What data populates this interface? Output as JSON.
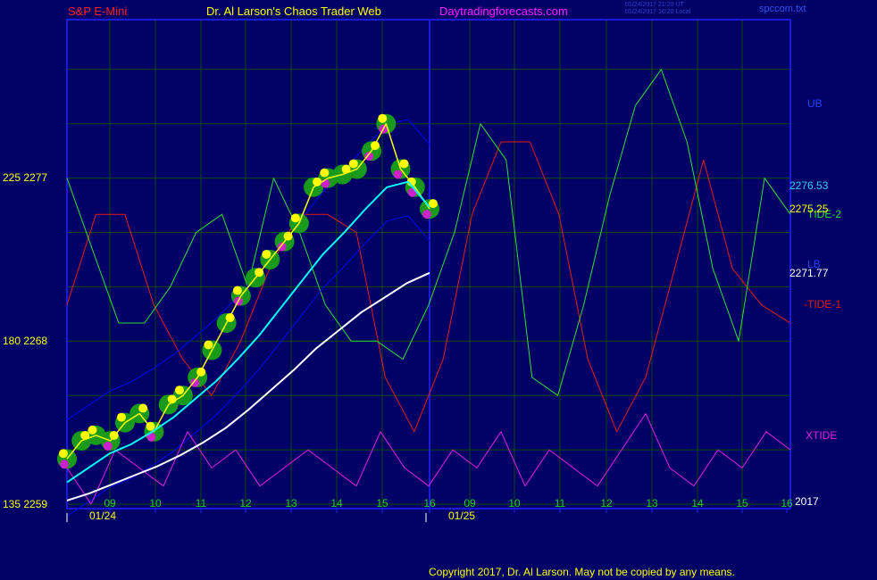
{
  "header": {
    "instrument": "S&P E-Mini",
    "brand": "Dr. Al Larson's Chaos Trader Web",
    "site": "Daytradingforecasts.com",
    "stamp_line1": "01/24/2017 21:20 UT",
    "stamp_line2": "01/24/2017 16:20 Local",
    "filename": "spccom.txt"
  },
  "footer": {
    "copyright": "Copyright 2017, Dr. Al Larson. May not be copied by any means."
  },
  "colors": {
    "background": "#000066",
    "grid": "#0b4d0b",
    "frame": "#2222ff",
    "price": "#ffff00",
    "ema_short": "#00ffff",
    "ema_long": "#ffffff",
    "tide1": "#e02010",
    "tide2": "#33dd33",
    "xtide": "#dd22dd",
    "bands": "#0000ee"
  },
  "chart_data": {
    "type": "line",
    "y_ticks": [
      "225 2277",
      "180 2268",
      "135 2259"
    ],
    "y_range": [
      2259,
      2283
    ],
    "x_ticks": [
      "09",
      "10",
      "11",
      "12",
      "13",
      "14",
      "15",
      "16",
      "09",
      "10",
      "11",
      "12",
      "13",
      "14",
      "15",
      "16"
    ],
    "dates": [
      "01/24",
      "01/25"
    ],
    "year": "2017",
    "labels": {
      "ub": "UB",
      "lb": "LB",
      "tide2": "TIDE-2",
      "tide1": "-TIDE-1",
      "xtide": "XTIDE"
    },
    "value_labels": [
      "2276.53",
      "2275.25",
      "2271.77"
    ],
    "series": [
      {
        "name": "TIDE-2",
        "values": [
          2277,
          2273,
          2269,
          2269,
          2271,
          2274,
          2275,
          2271,
          2277,
          2274,
          2270,
          2268,
          2268,
          2267,
          2270,
          2274,
          2280,
          2278,
          2266,
          2265,
          2270,
          2276,
          2281,
          2283,
          2279,
          2272,
          2268,
          2277,
          2275
        ]
      },
      {
        "name": "-TIDE-1",
        "values": [
          2270,
          2275,
          2275,
          2270,
          2267,
          2265,
          2268,
          2272,
          2275,
          2275,
          2274,
          2266,
          2263,
          2267,
          2275,
          2279,
          2279,
          2275,
          2267,
          2263,
          2266,
          2272,
          2278,
          2272,
          2270,
          2269
        ]
      },
      {
        "name": "XTIDE",
        "values": [
          2261,
          2259,
          2262,
          2261,
          2260,
          2263,
          2261,
          2262,
          2260,
          2261,
          2262,
          2261,
          2260,
          2263,
          2261,
          2260,
          2262,
          2261,
          2263,
          2260,
          2262,
          2261,
          2260,
          2262,
          2264,
          2261,
          2260,
          2262,
          2261,
          2263,
          2262
        ]
      },
      {
        "name": "Price",
        "values": [
          2261.5,
          2262.5,
          2262.8,
          2262.5,
          2263.5,
          2264.0,
          2263.0,
          2264.5,
          2265.0,
          2266.0,
          2267.5,
          2269.0,
          2270.5,
          2271.5,
          2272.5,
          2273.5,
          2274.5,
          2276.5,
          2277.0,
          2277.2,
          2277.5,
          2278.5,
          2280.0,
          2277.5,
          2276.5,
          2275.3
        ]
      },
      {
        "name": "EMA short",
        "values": [
          2260.2,
          2261.0,
          2261.8,
          2262.3,
          2263.0,
          2263.8,
          2264.8,
          2265.8,
          2267.0,
          2268.3,
          2269.8,
          2271.3,
          2272.8,
          2274.0,
          2275.3,
          2276.5,
          2276.8,
          2275.4
        ]
      },
      {
        "name": "EMA long",
        "values": [
          2259.2,
          2259.6,
          2260.1,
          2260.6,
          2261.1,
          2261.7,
          2262.4,
          2263.2,
          2264.2,
          2265.3,
          2266.4,
          2267.6,
          2268.6,
          2269.6,
          2270.4,
          2271.2,
          2271.77
        ]
      }
    ]
  }
}
